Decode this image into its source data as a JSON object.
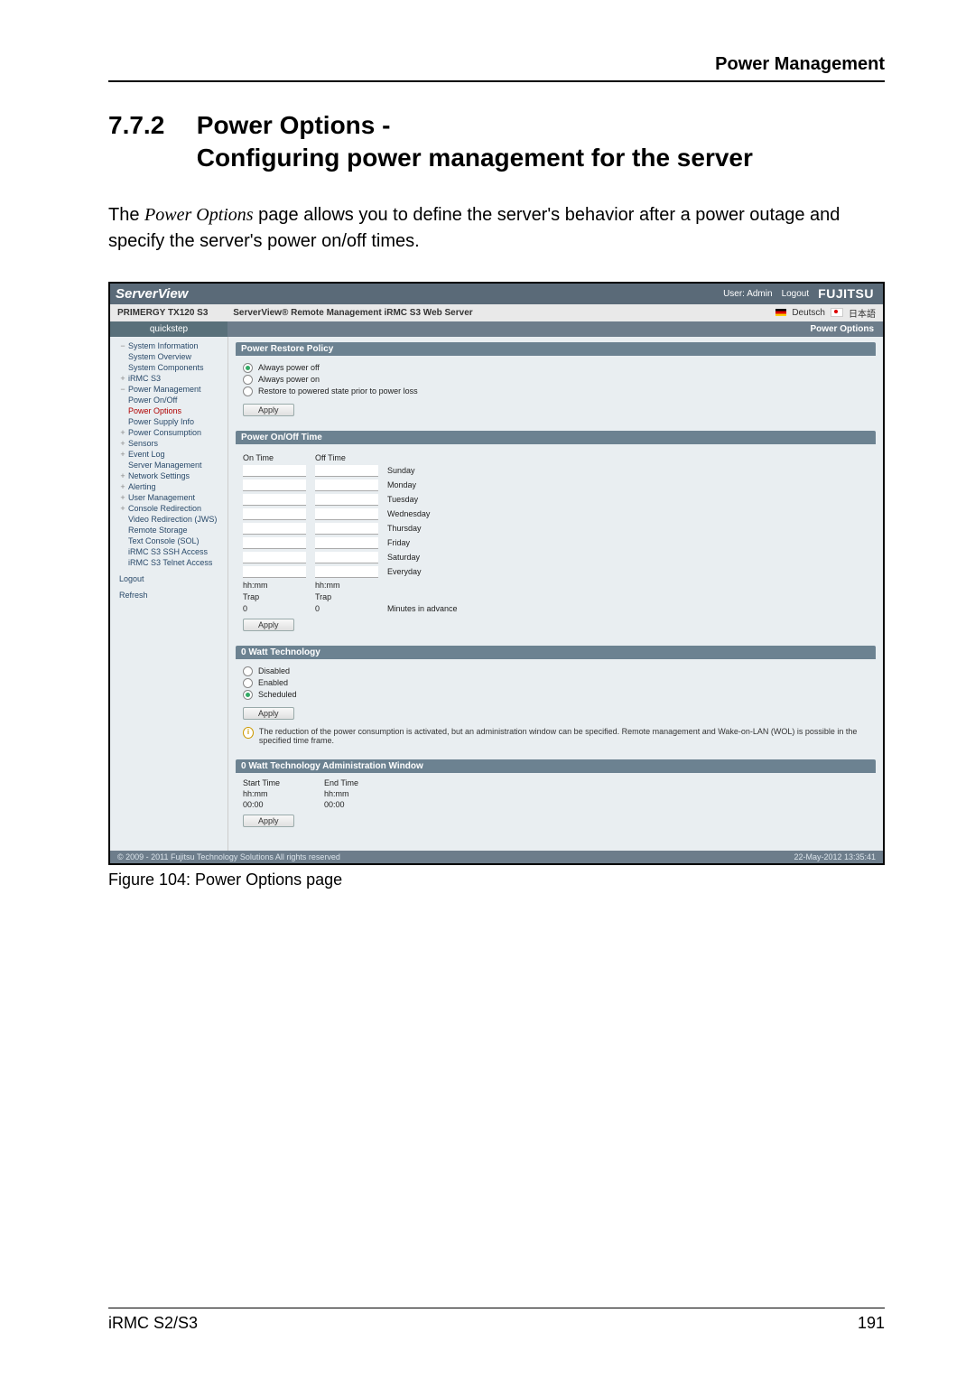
{
  "page_header": "Power Management",
  "section": {
    "number": "7.7.2",
    "title_line1": "Power Options -",
    "title_line2": "Configuring power management for the server"
  },
  "intro": {
    "pre": "The ",
    "italic": "Power Options",
    "post": " page allows you to define the server's behavior after a power outage and specify the server's power on/off times."
  },
  "fig": {
    "caption": "Figure 104: Power Options page"
  },
  "screenshot": {
    "brand": "ServerView",
    "user_prefix": "User:",
    "user": "Admin",
    "logout": "Logout",
    "vendor": "FUJITSU",
    "model": "PRIMERGY TX120 S3",
    "subtitle": "ServerView® Remote Management iRMC S3 Web Server",
    "lang_de": "Deutsch",
    "lang_jp": "日本語",
    "sidebar_crumb": "quickstep",
    "main_crumb": "Power Options",
    "nav": {
      "sys_info": "System Information",
      "sys_overview": "System Overview",
      "sys_components": "System Components",
      "irmc": "iRMC S3",
      "power_mgmt": "Power Management",
      "power_onoff": "Power On/Off",
      "power_options": "Power Options",
      "power_supply": "Power Supply Info",
      "power_cons": "Power Consumption",
      "sensors": "Sensors",
      "eventlog": "Event Log",
      "server_mgmt": "Server Management",
      "network": "Network Settings",
      "alerting": "Alerting",
      "user_mgmt": "User Management",
      "console": "Console Redirection",
      "video_jws": "Video Redirection (JWS)",
      "remote_storage": "Remote Storage",
      "text_console": "Text Console (SOL)",
      "ssh": "iRMC S3 SSH Access",
      "telnet": "iRMC S3 Telnet Access",
      "logout": "Logout",
      "refresh": "Refresh"
    },
    "panels": {
      "restore": {
        "title": "Power Restore Policy",
        "opt1": "Always power off",
        "opt2": "Always power on",
        "opt3": "Restore to powered state prior to power loss",
        "apply": "Apply"
      },
      "onoff": {
        "title": "Power On/Off Time",
        "on_time": "On Time",
        "off_time": "Off Time",
        "sun": "Sunday",
        "mon": "Monday",
        "tue": "Tuesday",
        "wed": "Wednesday",
        "thu": "Thursday",
        "fri": "Friday",
        "sat": "Saturday",
        "every": "Everyday",
        "hhmm1": "hh:mm",
        "hhmm2": "hh:mm",
        "trap": "Trap",
        "trap_val1": "0",
        "trap_val2": "0",
        "minutes": "Minutes in advance",
        "apply": "Apply"
      },
      "watt": {
        "title": "0 Watt Technology",
        "disabled": "Disabled",
        "enabled": "Enabled",
        "scheduled": "Scheduled",
        "apply": "Apply",
        "note": "The reduction of the power consumption is activated, but an administration window can be specified. Remote management and Wake-on-LAN (WOL) is possible in the specified time frame."
      },
      "window": {
        "title": "0 Watt Technology Administration Window",
        "start": "Start Time",
        "end": "End Time",
        "hhmm": "hh:mm",
        "val": "00:00",
        "apply": "Apply"
      }
    },
    "footer_left": "© 2009 - 2011 Fujitsu Technology Solutions All rights reserved",
    "footer_right": "22-May-2012 13:35:41"
  },
  "footer": {
    "left": "iRMC S2/S3",
    "right": "191"
  }
}
